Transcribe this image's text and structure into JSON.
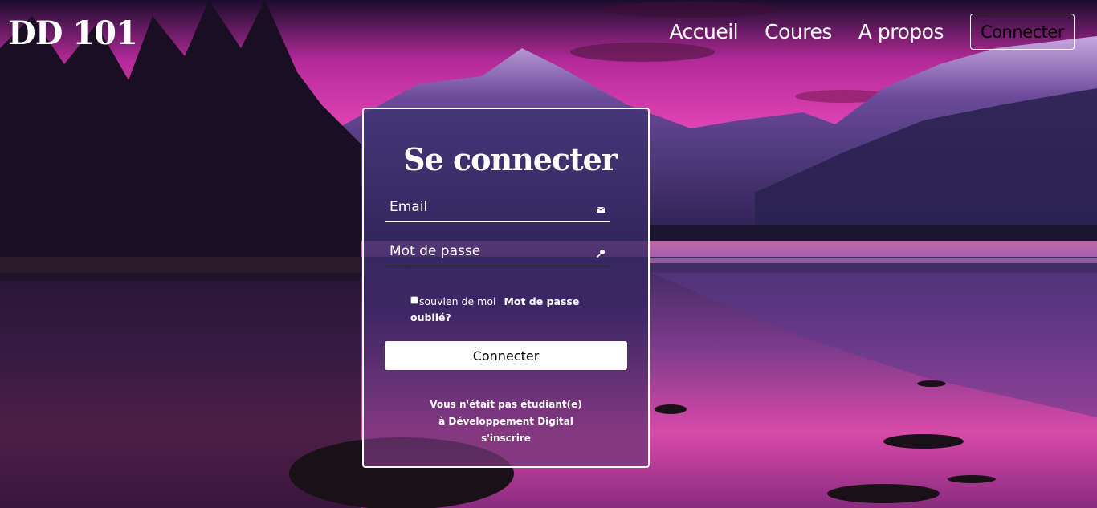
{
  "header": {
    "logo": "DD 101",
    "nav": [
      {
        "label": "Accueil"
      },
      {
        "label": "Coures"
      },
      {
        "label": "A propos"
      }
    ],
    "connect_button": "Connecter"
  },
  "login": {
    "title": "Se connecter",
    "email_placeholder": "Email",
    "email_icon": "envelope-icon",
    "password_placeholder": "Mot de passe",
    "password_icon": "key-icon",
    "remember_label": "souvien de moi",
    "forgot_link": "Mot de passe oublié?",
    "submit_label": "Connecter",
    "footer_line1": "Vous n'était pas étudiant(e)",
    "footer_line2": "à Développement Digital",
    "signup_link": "s'inscrire"
  },
  "colors": {
    "sky_top": "#1a0a2e",
    "sky_glow": "#e040c0",
    "mountain": "#4a3a7a",
    "water": "#c03aa0",
    "card_border": "#ffffff"
  }
}
